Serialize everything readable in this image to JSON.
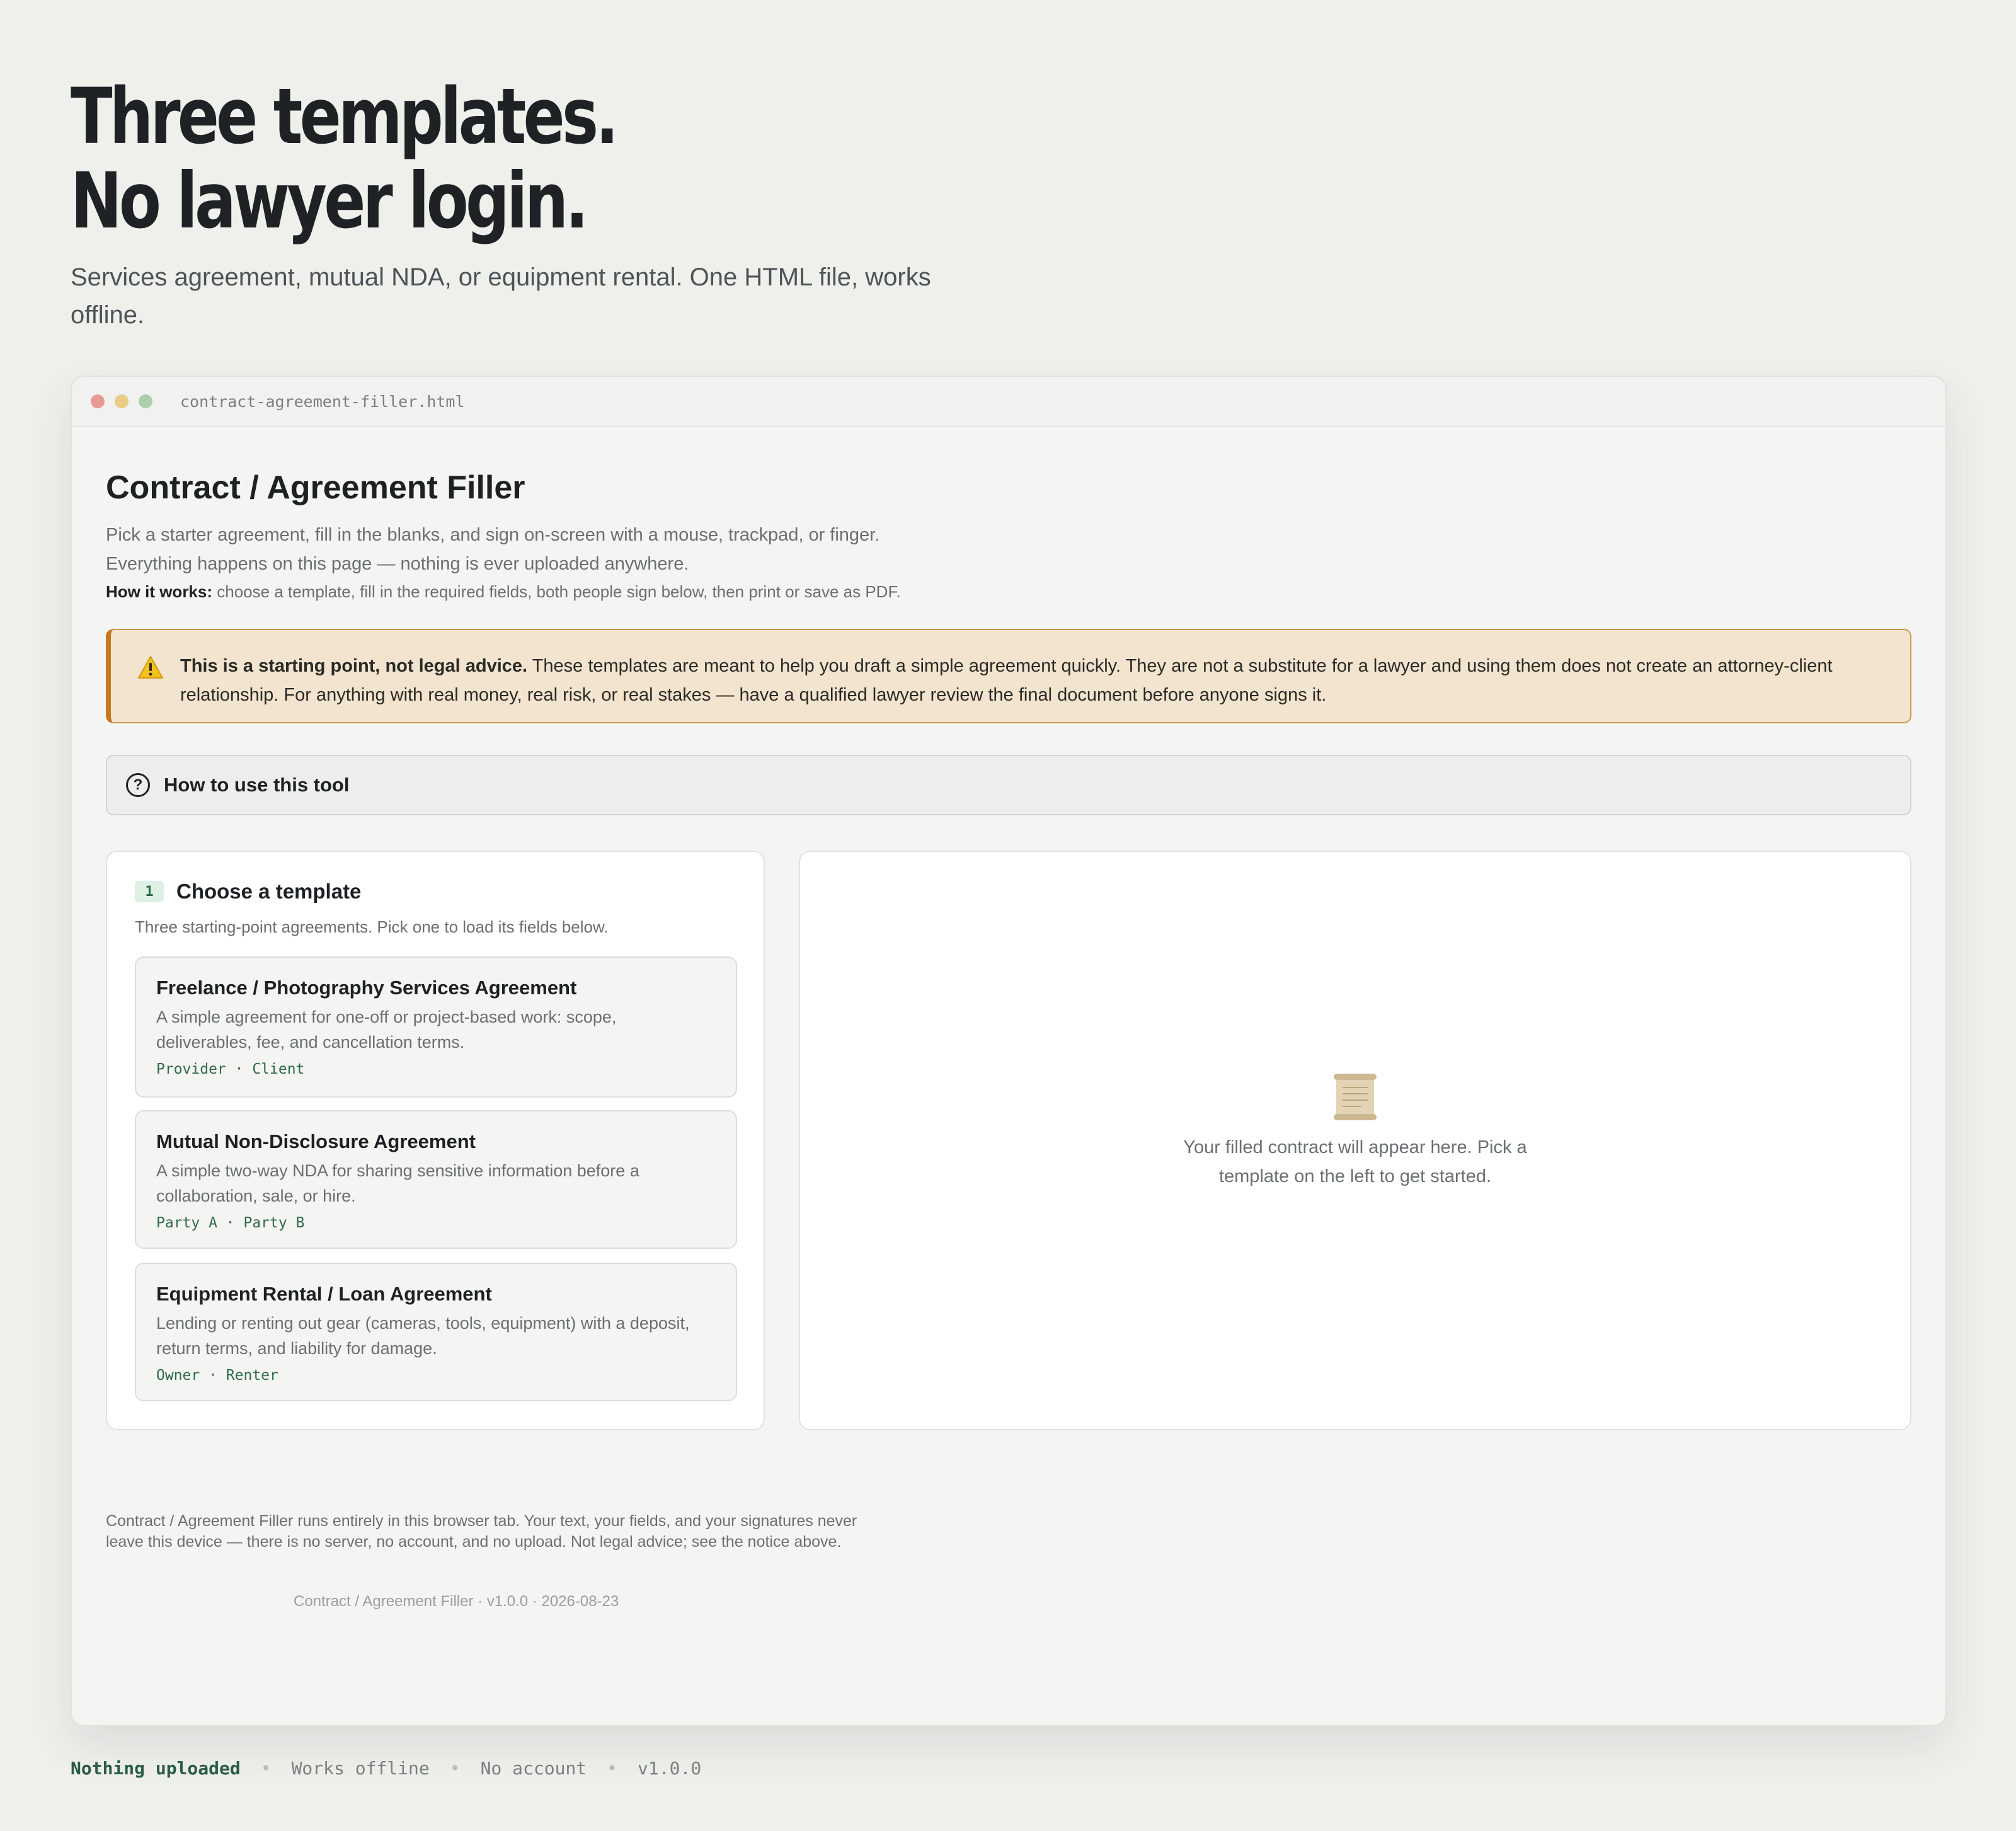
{
  "hero": {
    "title_line1": "Three templates.",
    "title_line2": "No lawyer login.",
    "subtitle": "Services agreement, mutual NDA, or equipment rental. One HTML file, works offline."
  },
  "window": {
    "file_name": "contract-agreement-filler.html"
  },
  "app": {
    "title": "Contract / Agreement Filler",
    "description": "Pick a starter agreement, fill in the blanks, and sign on-screen with a mouse, trackpad, or finger. Everything happens on this page — nothing is ever uploaded anywhere.",
    "how_it_works_label": "How it works:",
    "how_it_works_text": "choose a template, fill in the required fields, both people sign below, then print or save as PDF."
  },
  "warning": {
    "icon": "warning-icon",
    "bold": "This is a starting point, not legal advice.",
    "text": "These templates are meant to help you draft a simple agreement quickly. They are not a substitute for a lawyer and using them does not create an attorney-client relationship. For anything with real money, real risk, or real stakes — have a qualified lawyer review the final document before anyone signs it.",
    "accent": "#c27a22"
  },
  "howto": {
    "icon": "question-icon",
    "label": "How to use this tool"
  },
  "step1": {
    "badge": "1",
    "title": "Choose a template",
    "subtitle": "Three starting-point agreements. Pick one to load its fields below.",
    "templates": [
      {
        "title": "Freelance / Photography Services Agreement",
        "description": "A simple agreement for one-off or project-based work: scope, deliverables, fee, and cancellation terms.",
        "roles": "Provider · Client"
      },
      {
        "title": "Mutual Non-Disclosure Agreement",
        "description": "A simple two-way NDA for sharing sensitive information before a collaboration, sale, or hire.",
        "roles": "Party A · Party B"
      },
      {
        "title": "Equipment Rental / Loan Agreement",
        "description": "Lending or renting out gear (cameras, tools, equipment) with a deposit, return terms, and liability for damage.",
        "roles": "Owner · Renter"
      }
    ]
  },
  "preview": {
    "icon": "scroll-icon",
    "empty_text": "Your filled contract will appear here. Pick a template on the left to get started."
  },
  "footer": {
    "note": "Contract / Agreement Filler runs entirely in this browser tab. Your text, your fields, and your signatures never leave this device — there is no server, no account, and no upload. Not legal advice; see the notice above.",
    "version_line": "Contract / Agreement Filler · v1.0.0 · 2026-08-23"
  },
  "status": {
    "items": [
      "Nothing uploaded",
      "Works offline",
      "No account",
      "v1.0.0"
    ],
    "separator": "•"
  }
}
